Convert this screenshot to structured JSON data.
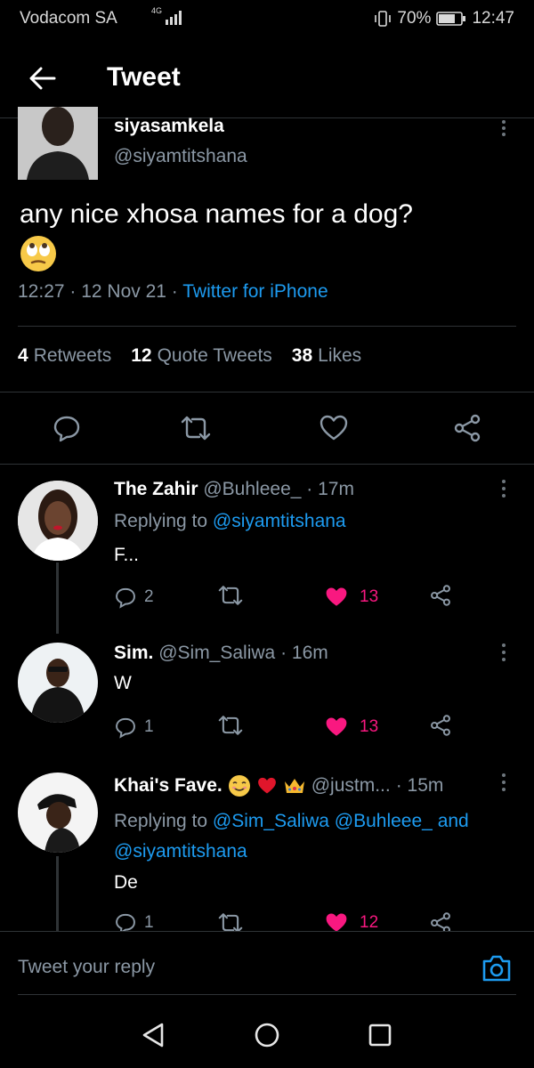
{
  "status_bar": {
    "carrier": "Vodacom SA",
    "network": "4G",
    "battery": "70%",
    "time": "12:47"
  },
  "header": {
    "title": "Tweet"
  },
  "main_tweet": {
    "author_name": "siyasamkela",
    "author_handle": "@siyamtitshana",
    "text": "any nice xhosa names for a dog?",
    "emoji": "face-with-rolling-eyes",
    "time": "12:27 · 12 Nov 21 · ",
    "source": "Twitter for iPhone",
    "stats": {
      "retweets_count": "4",
      "retweets_label": "Retweets",
      "quotes_count": "12",
      "quotes_label": "Quote Tweets",
      "likes_count": "38",
      "likes_label": "Likes"
    }
  },
  "replies": [
    {
      "name": "The Zahir",
      "handle": "@Buhleee_",
      "time": "· 17m",
      "replying_prefix": "Replying to ",
      "replying_to": "@siyamtitshana",
      "text": "F...",
      "replies": "2",
      "likes": "13"
    },
    {
      "name": "Sim.",
      "handle": "@Sim_Saliwa",
      "time": "· 16m",
      "text": "W",
      "replies": "1",
      "likes": "13"
    },
    {
      "name": "Khai's Fave.",
      "handle": "@justm...",
      "time": "· 15m",
      "replying_prefix": "Replying to ",
      "replying_to_1": "@Sim_Saliwa",
      "replying_to_2": "@Buhleee_",
      "replying_and": "and",
      "replying_to_3": "@siyamtitshana",
      "text": "De",
      "replies": "1",
      "likes": "12"
    }
  ],
  "composer": {
    "placeholder": "Tweet your reply"
  },
  "colors": {
    "accent": "#1d9bf0",
    "like": "#f91880",
    "muted": "#8b98a5",
    "divider": "#2f3336"
  }
}
